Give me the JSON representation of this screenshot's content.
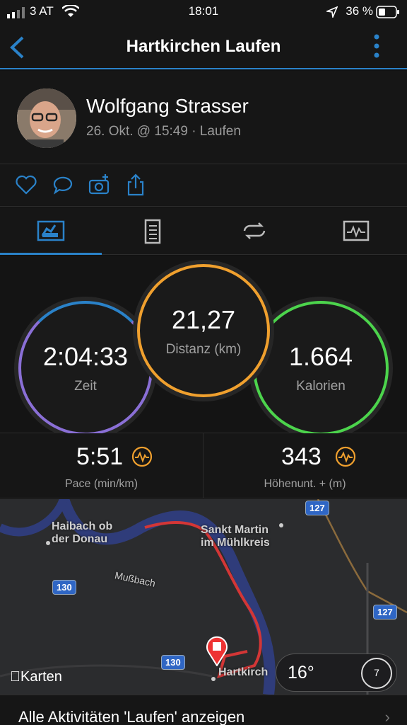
{
  "status_bar": {
    "carrier": "3 AT",
    "time": "18:01",
    "battery": "36 %"
  },
  "nav": {
    "title": "Hartkirchen Laufen"
  },
  "profile": {
    "name": "Wolfgang Strasser",
    "meta": "26. Okt. @ 15:49 · Laufen"
  },
  "actions": [
    "heart-icon",
    "comment-icon",
    "camera-add-icon",
    "share-icon"
  ],
  "tabs": [
    "overview-icon",
    "details-icon",
    "laps-icon",
    "chart-icon"
  ],
  "rings": {
    "zeit": {
      "value": "2:04:33",
      "label": "Zeit",
      "color": "#8a6fd6"
    },
    "distanz": {
      "value": "21,27",
      "label": "Distanz (km)",
      "color": "#f0a02e"
    },
    "kalorien": {
      "value": "1.664",
      "label": "Kalorien",
      "color": "#4cd44c"
    }
  },
  "stats": {
    "pace": {
      "value": "5:51",
      "label": "Pace (min/km)"
    },
    "hoehe": {
      "value": "343",
      "label": "Höhenunt. + (m)"
    }
  },
  "map": {
    "places": [
      "Haibach ob\nder Donau",
      "Sankt Martin\nim Mühlkreis",
      "Mußbach",
      "Hartkirch"
    ],
    "roads": [
      "127",
      "130",
      "127",
      "130"
    ],
    "brand": "Karten",
    "weather": {
      "temp": "16°",
      "wind": "7"
    },
    "route_color": "#d33636"
  },
  "footer": {
    "link": "Alle Aktivitäten 'Laufen' anzeigen"
  },
  "colors": {
    "accent": "#2a82c9",
    "pace_icon": "#f0a02e"
  }
}
